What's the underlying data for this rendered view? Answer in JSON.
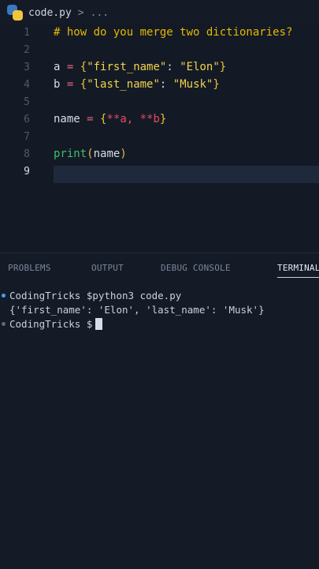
{
  "breadcrumb": {
    "file": "code.py",
    "separator": ">",
    "more": "..."
  },
  "editor": {
    "lines": [
      {
        "num": "1",
        "comment": "# how do you merge two dictionaries?"
      },
      {
        "num": "2"
      },
      {
        "num": "3",
        "var": "a",
        "op": "=",
        "open": "{",
        "key": "\"first_name\"",
        "colon": ":",
        "value": "\"Elon\"",
        "close": "}"
      },
      {
        "num": "4",
        "var": "b",
        "op": "=",
        "open": "{",
        "key": "\"last_name\"",
        "colon": ":",
        "value": "\"Musk\"",
        "close": "}"
      },
      {
        "num": "5"
      },
      {
        "num": "6",
        "var": "name",
        "op": "=",
        "open": "{",
        "body": "**a, **b",
        "close": "}"
      },
      {
        "num": "7"
      },
      {
        "num": "8",
        "fn": "print",
        "paren_open": "(",
        "arg": "name",
        "paren_close": ")"
      },
      {
        "num": "9"
      }
    ],
    "active_line": "9"
  },
  "panel": {
    "tabs": [
      "PROBLEMS",
      "OUTPUT",
      "DEBUG CONSOLE",
      "TERMINAL"
    ],
    "active_tab": "TERMINAL",
    "terminal": {
      "line1": "CodingTricks $python3 code.py",
      "line2": "{'first_name': 'Elon', 'last_name': 'Musk'}",
      "line3": "CodingTricks $"
    }
  },
  "colors": {
    "background": "#131a26",
    "comment": "#e6b800",
    "string": "#f2d34a",
    "operator": "#e8657a",
    "function": "#3fbf6a",
    "terminal_dot": "#3fa0ff"
  }
}
